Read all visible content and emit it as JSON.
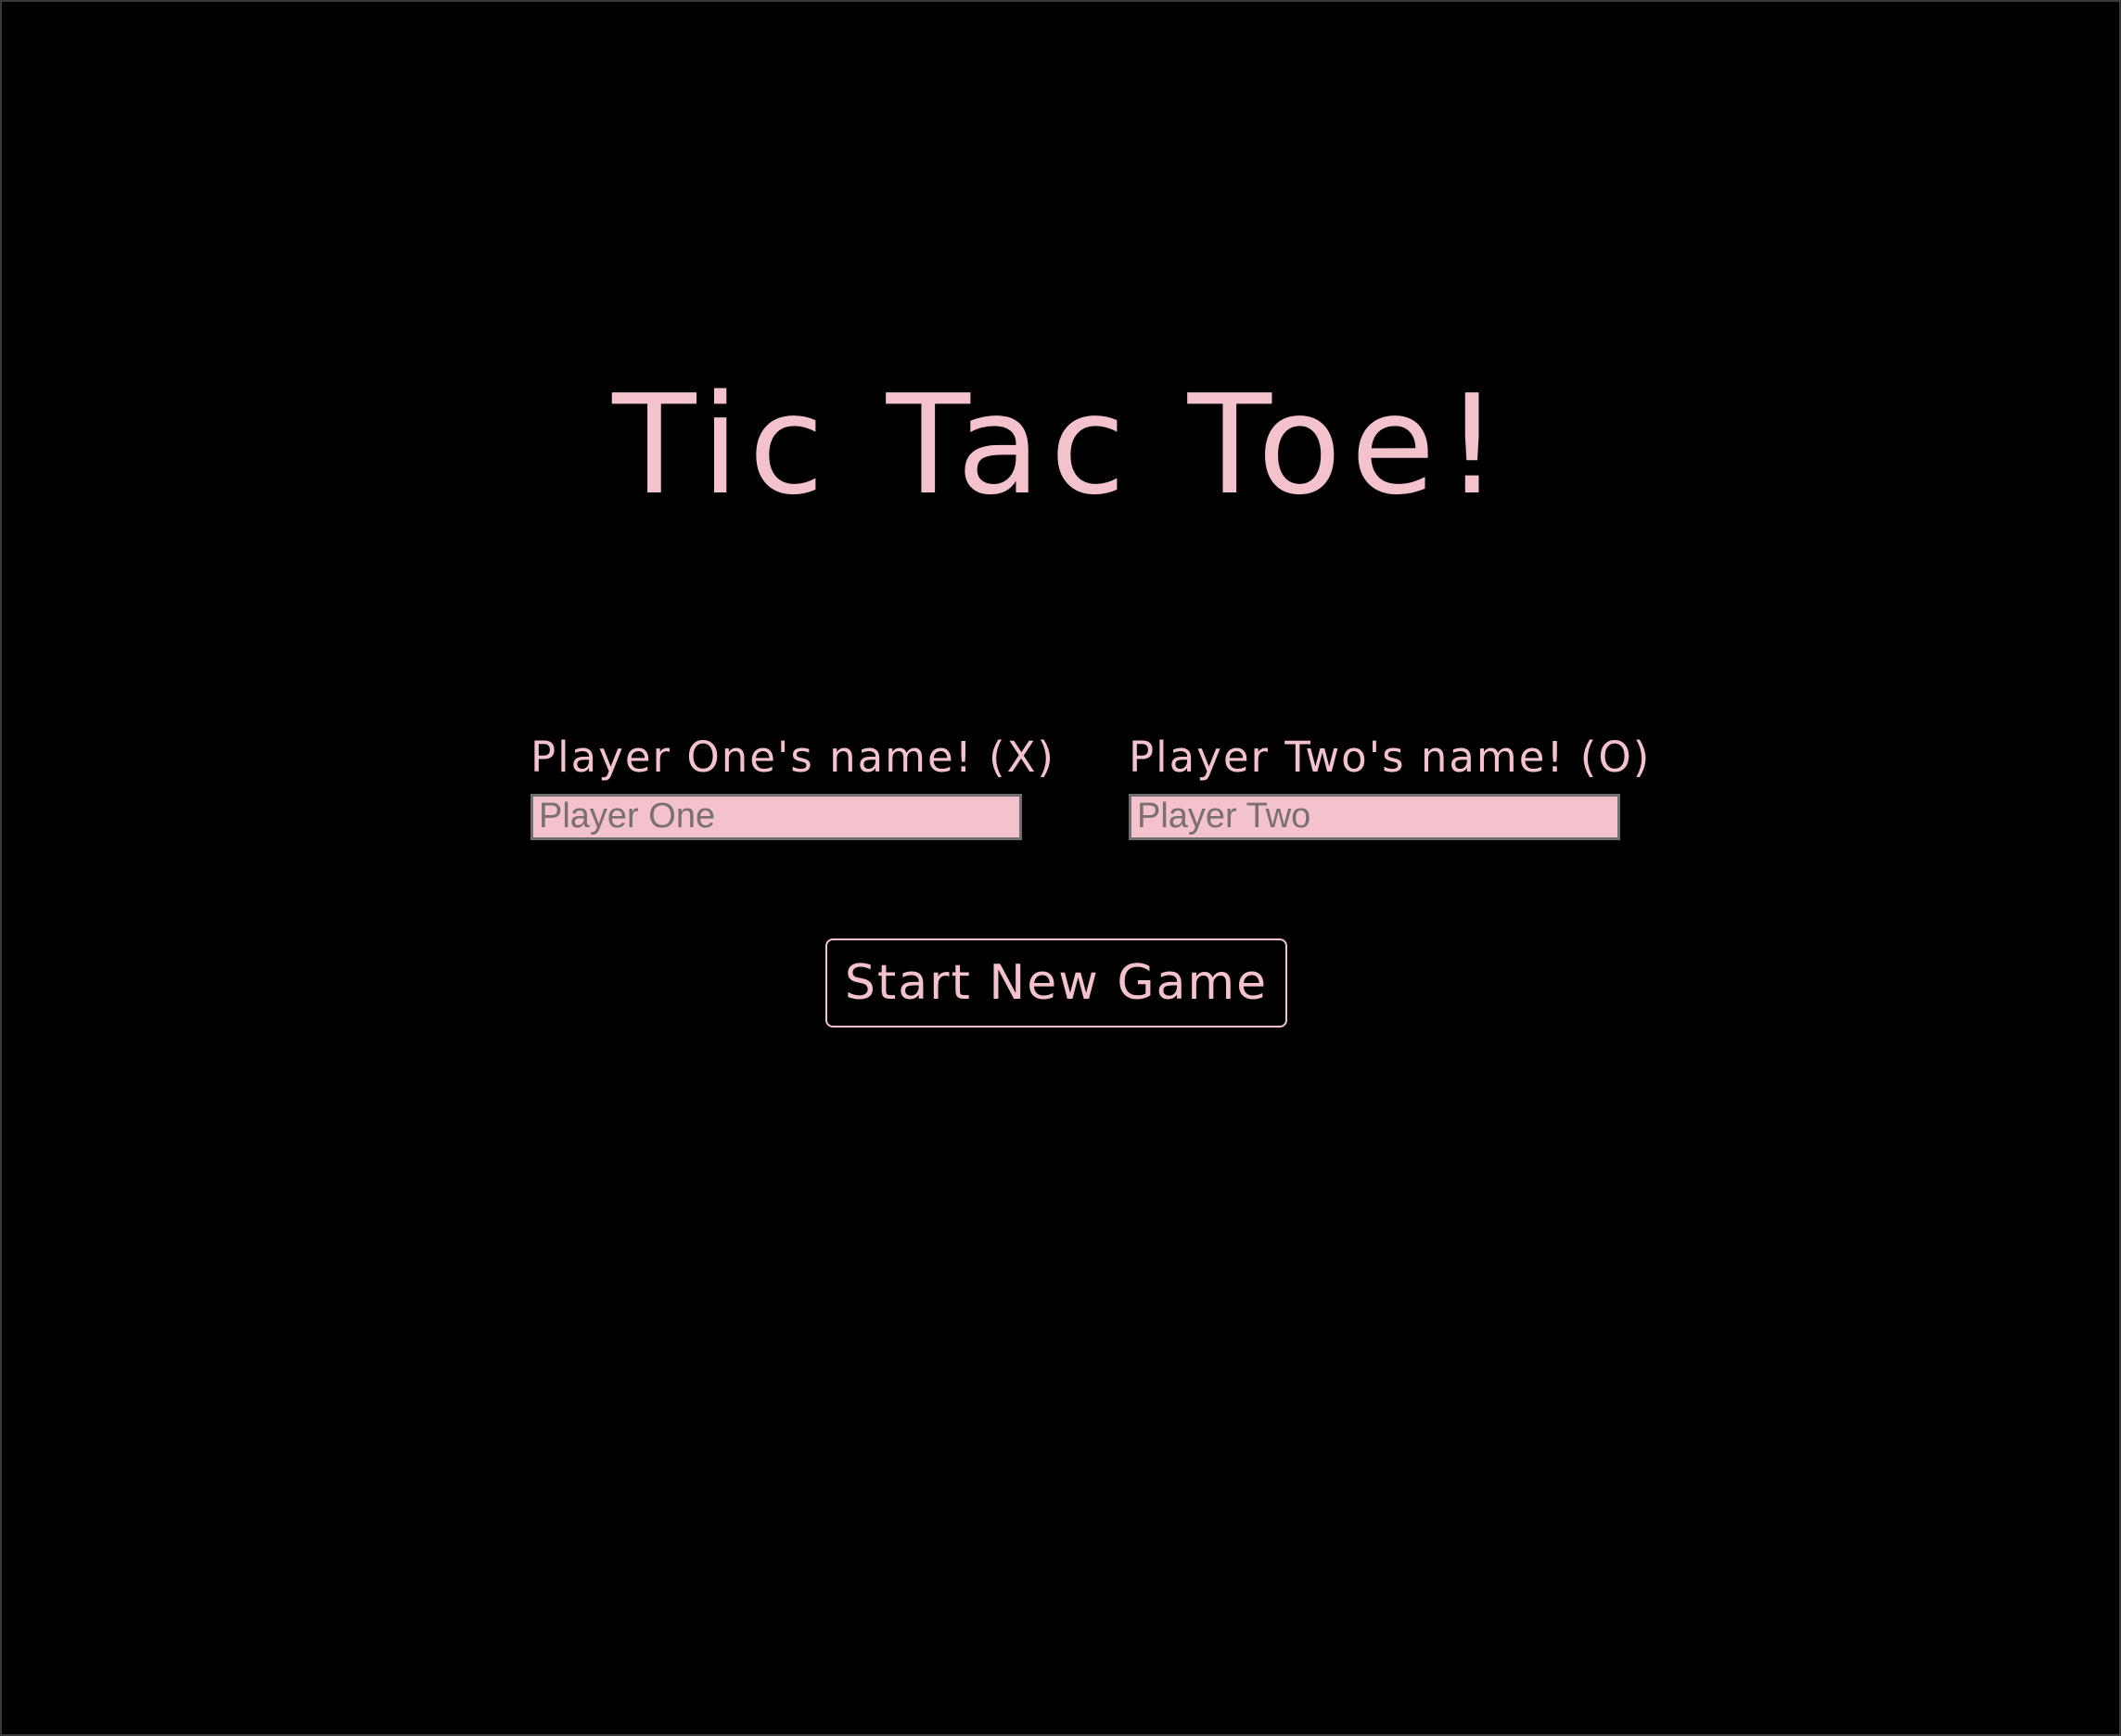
{
  "colors": {
    "background": "#000000",
    "accent": "#f4c2cc",
    "input_border": "#6f6f6f"
  },
  "title": "Tic Tac Toe!",
  "players": [
    {
      "label": "Player One's name! (X)",
      "placeholder": "Player One",
      "value": ""
    },
    {
      "label": "Player Two's name! (O)",
      "placeholder": "Player Two",
      "value": ""
    }
  ],
  "start_button_label": "Start New Game"
}
